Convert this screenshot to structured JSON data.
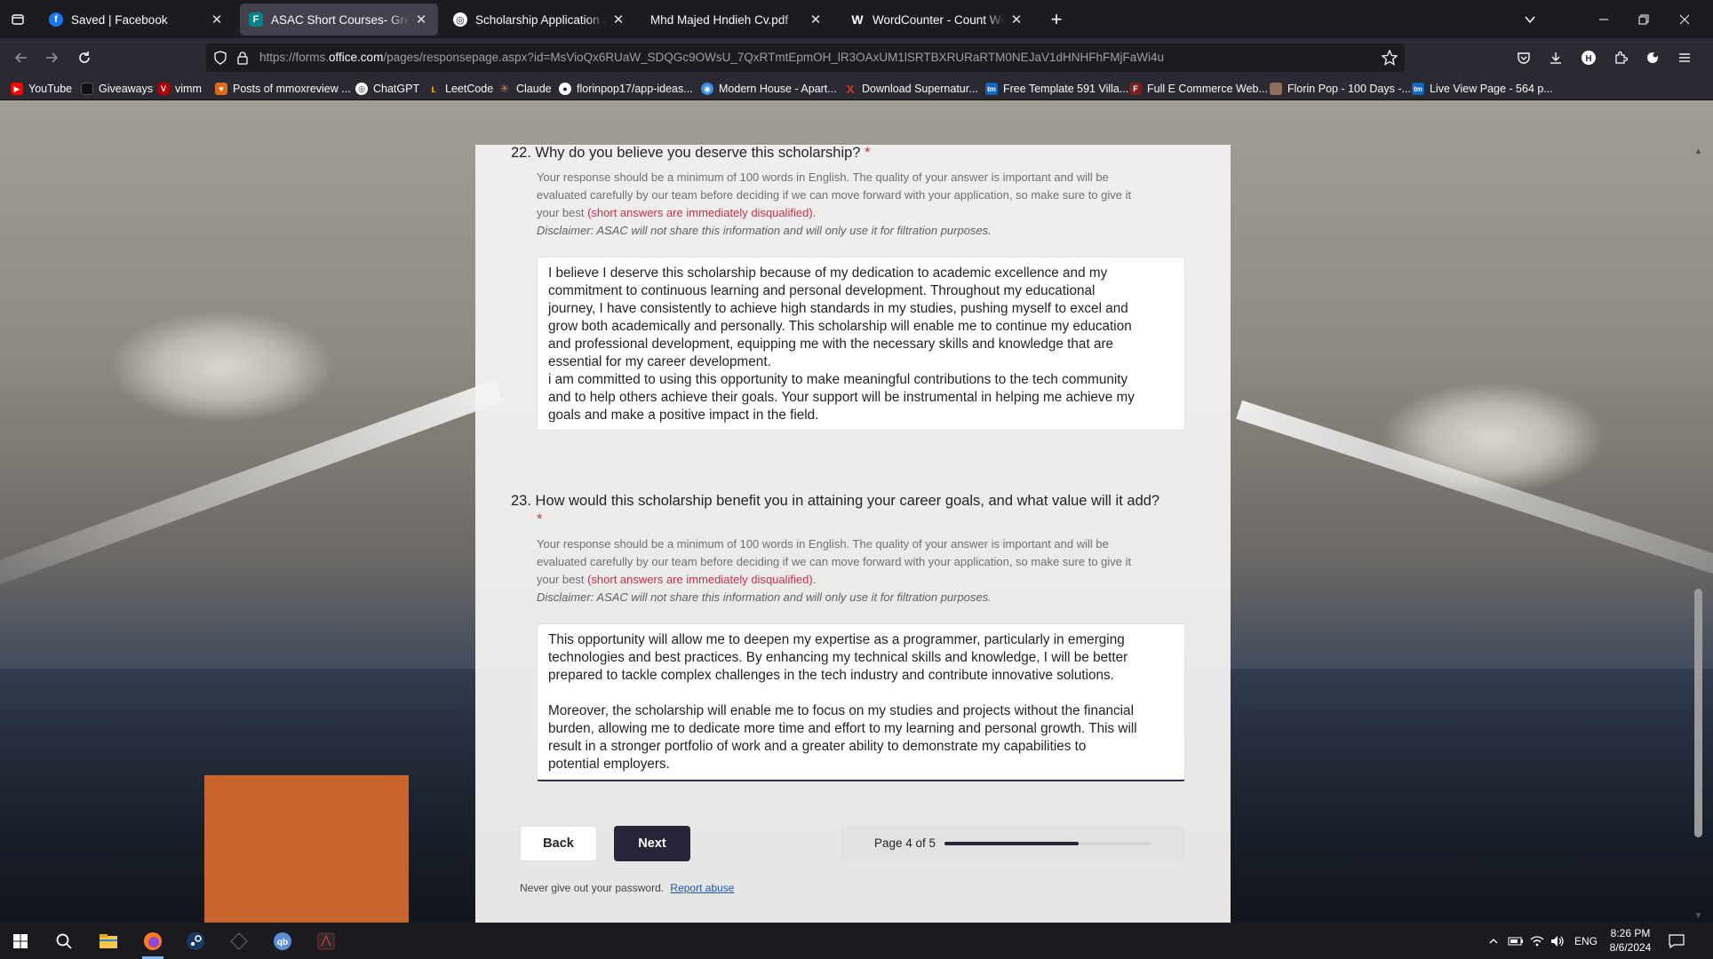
{
  "browser": {
    "tabs": [
      {
        "title": "Saved | Facebook",
        "active": false,
        "icon": "facebook-icon",
        "color": "#1877f2"
      },
      {
        "title": "ASAC Short Courses- Green Skills",
        "active": true,
        "icon": "forms-icon",
        "color": "#038387"
      },
      {
        "title": "Scholarship Application Justification",
        "active": false,
        "icon": "chatgpt-icon",
        "color": "#ffffff"
      },
      {
        "title": "Mhd Majed Hndieh Cv.pdf",
        "active": false,
        "icon": "pdf-icon",
        "color": "#2b2a33"
      },
      {
        "title": "WordCounter - Count Words &",
        "active": false,
        "icon": "wordcounter-icon",
        "color": "#ffffff"
      }
    ],
    "new_tab_label": "+",
    "url_prefix": "https://forms.",
    "url_domain": "office.com",
    "url_rest": "/pages/responsepage.aspx?id=MsVioQx6RUaW_SDQGc9OWsU_7QxRTmtEpmOH_lR3OAxUM1lSRTBXRURaRTM0NEJaV1dHNHFhFMjFaWi4u",
    "bookmarks": [
      {
        "label": "YouTube",
        "color": "#ff0000",
        "glyph": "▶"
      },
      {
        "label": "Giveaways",
        "color": "#111111",
        "glyph": "■"
      },
      {
        "label": "vimm",
        "color": "#b00000",
        "glyph": "V"
      },
      {
        "label": "Posts of mmoxreview ...",
        "color": "#e06a1b",
        "glyph": "♥"
      },
      {
        "label": "ChatGPT",
        "color": "#ffffff",
        "glyph": "◎"
      },
      {
        "label": "LeetCode",
        "color": "#f89f1b",
        "glyph": "ʟ"
      },
      {
        "label": "Claude",
        "color": "#d97757",
        "glyph": "✳"
      },
      {
        "label": "florinpop17/app-ideas...",
        "color": "#ffffff",
        "glyph": "●"
      },
      {
        "label": "Modern House - Apart...",
        "color": "#3a8ee6",
        "glyph": "◉"
      },
      {
        "label": "Download Supernatur...",
        "color": "#e03a1e",
        "glyph": "X"
      },
      {
        "label": "Free Template 591 Villa...",
        "color": "#1565c0",
        "glyph": "tm"
      },
      {
        "label": "Full E Commerce Web...",
        "color": "#7a1f1f",
        "glyph": "F"
      },
      {
        "label": "Florin Pop - 100 Days -...",
        "color": "#8e6e5a",
        "glyph": "▣"
      },
      {
        "label": "Live View Page - 564 p...",
        "color": "#1565c0",
        "glyph": "tm"
      }
    ]
  },
  "form": {
    "q22": {
      "number": "22.",
      "title": "Why do you believe you deserve this scholarship?",
      "required_mark": "*",
      "hint_line1": "Your response should be a minimum of 100 words in English. The quality of your answer is important and will be",
      "hint_line2": "evaluated carefully by our team before deciding if we can move forward with your application, so make sure to give it",
      "hint_line3_prefix": "your best ",
      "hint_red": "(short answers are immediately disqualified)",
      "hint_line3_suffix": ".",
      "disclaimer": "Disclaimer: ASAC will not share this information and will only use it for filtration purposes.",
      "answer": "I believe I deserve this scholarship because of my dedication to academic excellence and my\ncommitment to continuous learning and personal development. Throughout my educational\njourney, I have consistently to achieve high standards in my studies, pushing myself to excel and\ngrow both academically and personally. This scholarship will enable me to continue my education\nand professional development, equipping me with the necessary skills and knowledge that are\nessential for my career development.\ni am committed to using this opportunity to make meaningful contributions to the tech community\nand to help others achieve their goals. Your support will be instrumental in helping me achieve my\ngoals and make a positive impact in the field."
    },
    "q23": {
      "number": "23.",
      "title": "How would this scholarship benefit you in attaining your career goals, and what value will it add?",
      "required_mark": "*",
      "hint_line1": "Your response should be a minimum of 100 words in English. The quality of your answer is important and will be",
      "hint_line2": "evaluated carefully by our team before deciding if we can move forward with your application, so make sure to give it",
      "hint_line3_prefix": "your best ",
      "hint_red": "(short answers are immediately disqualified)",
      "hint_line3_suffix": ".",
      "disclaimer": "Disclaimer: ASAC will not share this information and will only use it for filtration purposes.",
      "answer": "This opportunity will allow me to deepen my expertise as a programmer, particularly in emerging\ntechnologies and best practices. By enhancing my technical skills and knowledge, I will be better\nprepared to tackle complex challenges in the tech industry and contribute innovative solutions.\n\nMoreover, the scholarship will enable me to focus on my studies and projects without the financial\nburden, allowing me to dedicate more time and effort to my learning and personal growth. This will\nresult in a stronger portfolio of work and a greater ability to demonstrate my capabilities to\npotential employers."
    },
    "back_label": "Back",
    "next_label": "Next",
    "page_label": "Page 4 of 5",
    "progress_fraction": 0.65,
    "footer_text": "Never give out your password.",
    "report_abuse": "Report abuse"
  },
  "taskbar": {
    "language": "ENG",
    "time": "8:26 PM",
    "date": "8/6/2024"
  }
}
